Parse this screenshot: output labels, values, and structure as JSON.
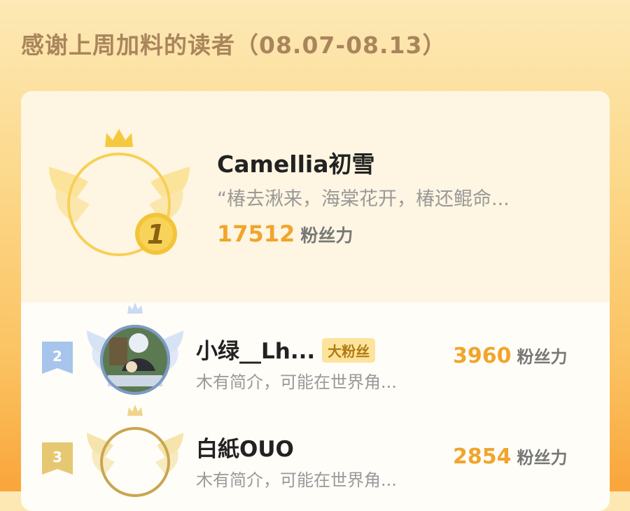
{
  "header": {
    "title": "感谢上周加料的读者（08.07-08.13）"
  },
  "ranking": [
    {
      "rank": "1",
      "name": "Camellia初雪",
      "bio": "“椿去湫来，海棠花开，椿还鲲命...",
      "score": "17512",
      "unit": "粉丝力",
      "badge_color": "#f3c43a"
    },
    {
      "rank": "2",
      "name": "小绿__Lh...",
      "tag": "大粉丝",
      "bio": "木有简介，可能在世界角...",
      "score": "3960",
      "unit": "粉丝力",
      "badge_color": "#a7c4ec"
    },
    {
      "rank": "3",
      "name": "白紙OUO",
      "bio": "木有简介，可能在世界角...",
      "score": "2854",
      "unit": "粉丝力",
      "badge_color": "#e6c872"
    }
  ],
  "colors": {
    "score": "#f0a52c",
    "gold": "#f3c43a",
    "silver_blue": "#a7c4ec"
  }
}
